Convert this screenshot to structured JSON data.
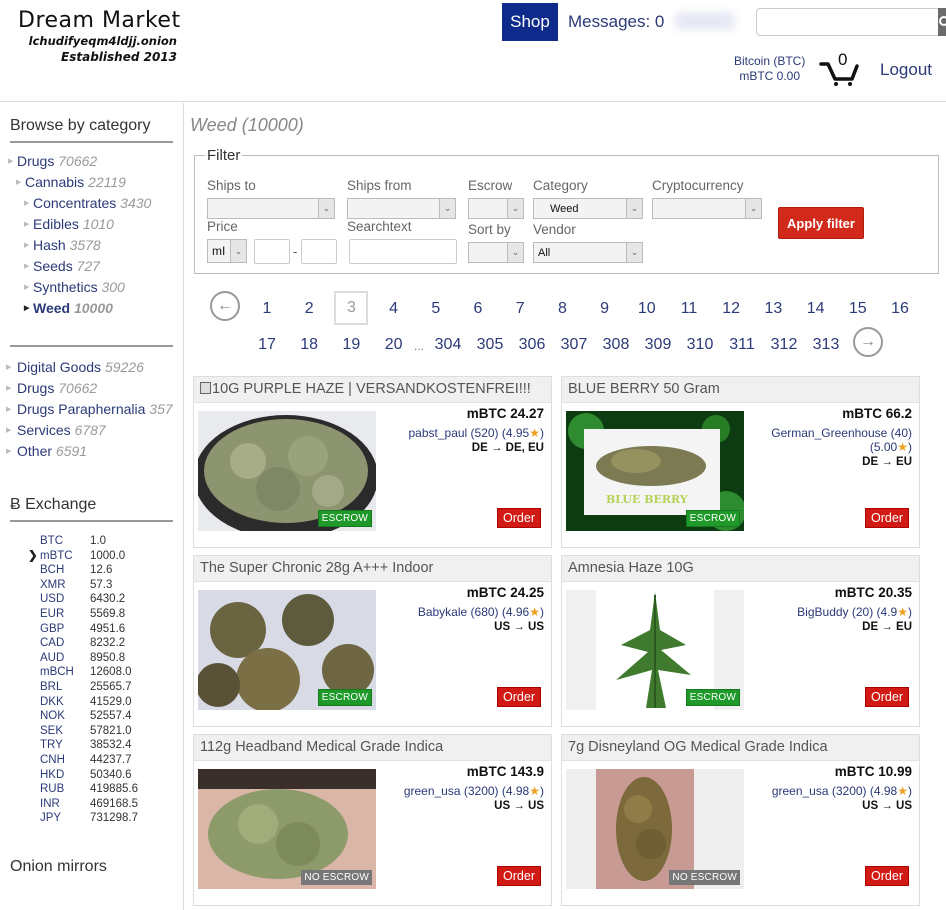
{
  "header": {
    "logo_title": "Dream Market",
    "logo_onion": "lchudifyeqm4ldjj.onion",
    "logo_established": "Established 2013",
    "shop_label": "Shop",
    "messages_label": "Messages: 0",
    "search_placeholder": "",
    "currency_label": "Bitcoin (BTC)",
    "balance": "mBTC 0.00",
    "cart_count": "0",
    "logout_label": "Logout"
  },
  "sidebar": {
    "browse_heading": "Browse by category",
    "tree": [
      {
        "label": "Drugs",
        "count": "70662",
        "level": 0
      },
      {
        "label": "Cannabis",
        "count": "22119",
        "level": 1
      },
      {
        "label": "Concentrates",
        "count": "3430",
        "level": 2
      },
      {
        "label": "Edibles",
        "count": "1010",
        "level": 2
      },
      {
        "label": "Hash",
        "count": "3578",
        "level": 2
      },
      {
        "label": "Seeds",
        "count": "727",
        "level": 2
      },
      {
        "label": "Synthetics",
        "count": "300",
        "level": 2
      },
      {
        "label": "Weed",
        "count": "10000",
        "level": 2,
        "active": true
      }
    ],
    "top_categories": [
      {
        "label": "Digital Goods",
        "count": "59226"
      },
      {
        "label": "Drugs",
        "count": "70662"
      },
      {
        "label": "Drugs Paraphernalia",
        "count": "357"
      },
      {
        "label": "Services",
        "count": "6787"
      },
      {
        "label": "Other",
        "count": "6591"
      }
    ],
    "exchange_heading": "Ƀ Exchange",
    "exchange_selected": "mBTC",
    "exchange": [
      {
        "currency": "BTC",
        "rate": "1.0"
      },
      {
        "currency": "mBTC",
        "rate": "1000.0"
      },
      {
        "currency": "BCH",
        "rate": "12.6"
      },
      {
        "currency": "XMR",
        "rate": "57.3"
      },
      {
        "currency": "USD",
        "rate": "6430.2"
      },
      {
        "currency": "EUR",
        "rate": "5569.8"
      },
      {
        "currency": "GBP",
        "rate": "4951.6"
      },
      {
        "currency": "CAD",
        "rate": "8232.2"
      },
      {
        "currency": "AUD",
        "rate": "8950.8"
      },
      {
        "currency": "mBCH",
        "rate": "12608.0"
      },
      {
        "currency": "BRL",
        "rate": "25565.7"
      },
      {
        "currency": "DKK",
        "rate": "41529.0"
      },
      {
        "currency": "NOK",
        "rate": "52557.4"
      },
      {
        "currency": "SEK",
        "rate": "57821.0"
      },
      {
        "currency": "TRY",
        "rate": "38532.4"
      },
      {
        "currency": "CNH",
        "rate": "44237.7"
      },
      {
        "currency": "HKD",
        "rate": "50340.6"
      },
      {
        "currency": "RUB",
        "rate": "419885.6"
      },
      {
        "currency": "INR",
        "rate": "469168.5"
      },
      {
        "currency": "JPY",
        "rate": "731298.7"
      }
    ],
    "mirrors_heading": "Onion mirrors"
  },
  "main": {
    "title": "Weed (10000)",
    "filter": {
      "legend": "Filter",
      "ships_to_label": "Ships to",
      "ships_to_value": "",
      "ships_from_label": "Ships from",
      "ships_from_value": "",
      "escrow_label": "Escrow",
      "escrow_value": "",
      "category_label": "Category",
      "category_value": "Weed",
      "crypto_label": "Cryptocurrency",
      "crypto_value": "",
      "price_label": "Price",
      "price_unit_value": "mI",
      "price_min": "",
      "price_max": "",
      "price_separator": "-",
      "searchtext_label": "Searchtext",
      "searchtext_value": "",
      "sortby_label": "Sort by",
      "sortby_value": "",
      "vendor_label": "Vendor",
      "vendor_value": "All",
      "apply_label": "Apply filter"
    },
    "pagination": {
      "current": "3",
      "row1": [
        "1",
        "2",
        "3",
        "4",
        "5",
        "6",
        "7",
        "8",
        "9",
        "10",
        "11",
        "12",
        "13",
        "14",
        "15",
        "16"
      ],
      "row2a": [
        "17",
        "18",
        "19",
        "20"
      ],
      "ellipsis": "...",
      "row2b": [
        "304",
        "305",
        "306",
        "307",
        "308",
        "309",
        "310",
        "311",
        "312",
        "313"
      ]
    },
    "listings": [
      {
        "title": "10G PURPLE HAZE | VERSANDKOSTENFREI!!!",
        "has_icon": true,
        "price": "mBTC 24.27",
        "vendor": "pabst_paul (520) (4.95",
        "vendor_line2": "",
        "route": "DE → DE, EU",
        "escrow": "ESCROW",
        "order": "Order"
      },
      {
        "title": "BLUE BERRY 50 Gram",
        "has_icon": false,
        "price": "mBTC 66.2",
        "vendor": "German_Greenhouse (40)",
        "vendor_line2": "(5.00",
        "route": "DE → EU",
        "escrow": "ESCROW",
        "order": "Order"
      },
      {
        "title": "The Super Chronic 28g A+++ Indoor",
        "has_icon": false,
        "price": "mBTC 24.25",
        "vendor": "Babykale (680) (4.96",
        "vendor_line2": "",
        "route": "US → US",
        "escrow": "ESCROW",
        "order": "Order"
      },
      {
        "title": "Amnesia Haze 10G",
        "has_icon": false,
        "price": "mBTC 20.35",
        "vendor": "BigBuddy (20) (4.9",
        "vendor_line2": "",
        "route": "DE → EU",
        "escrow": "ESCROW",
        "order": "Order"
      },
      {
        "title": "112g Headband Medical Grade Indica",
        "has_icon": false,
        "price": "mBTC 143.9",
        "vendor": "green_usa (3200) (4.98",
        "vendor_line2": "",
        "route": "US → US",
        "escrow": "NO ESCROW",
        "order": "Order"
      },
      {
        "title": "7g Disneyland OG Medical Grade Indica",
        "has_icon": false,
        "price": "mBTC 10.99",
        "vendor": "green_usa (3200) (4.98",
        "vendor_line2": "",
        "route": "US → US",
        "escrow": "NO ESCROW",
        "order": "Order"
      }
    ]
  }
}
